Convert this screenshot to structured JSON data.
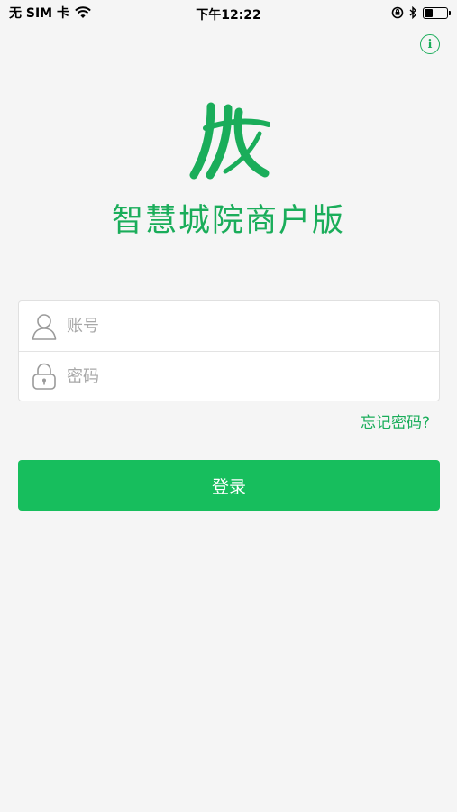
{
  "status_bar": {
    "carrier": "无 SIM 卡",
    "time": "下午12:22",
    "battery_level": 0.35,
    "icons": [
      "wifi-icon",
      "orientation-lock-icon",
      "bluetooth-icon",
      "battery-icon"
    ]
  },
  "header": {
    "info_icon": "info-icon",
    "info_glyph": "i"
  },
  "brand": {
    "logo": "city-courtyard-logo",
    "title": "智慧城院商户版",
    "color": "#1aad5a"
  },
  "form": {
    "account_placeholder": "账号",
    "password_placeholder": "密码",
    "account_icon": "user-icon",
    "password_icon": "lock-icon",
    "forgot_label": "忘记密码?",
    "login_label": "登录",
    "button_color": "#17be5d"
  }
}
